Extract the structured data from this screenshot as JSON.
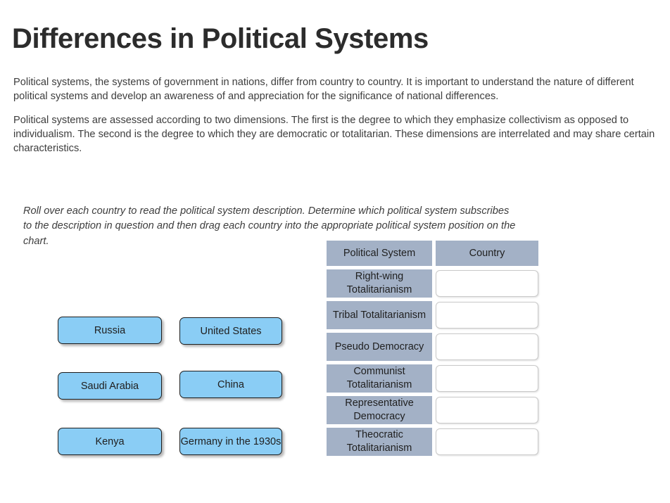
{
  "page": {
    "title": "Differences in Political Systems",
    "paragraphs": [
      "Political systems, the systems of government in nations, differ from country to country. It is important to understand the nature of different political systems and develop an awareness of and appreciation for the significance of national differences.",
      "Political systems are assessed according to two dimensions. The first is the degree to which they emphasize collectivism as opposed to individualism. The second is the degree to which they are democratic or totalitarian. These dimensions are interrelated and may share certain characteristics."
    ],
    "instructions": "Roll over each country to read the political system description. Determine which political system subscribes to the description in question and then drag each country into the appropriate political system position on the chart."
  },
  "countries": [
    {
      "label": "Russia"
    },
    {
      "label": "United States"
    },
    {
      "label": "Saudi Arabia"
    },
    {
      "label": "China"
    },
    {
      "label": "Kenya"
    },
    {
      "label": "Germany in the 1930s"
    }
  ],
  "table": {
    "headers": {
      "political_system": "Political System",
      "country": "Country"
    },
    "rows": [
      {
        "political_system": "Right-wing Totalitarianism",
        "country": ""
      },
      {
        "political_system": "Tribal Totalitarianism",
        "country": ""
      },
      {
        "political_system": "Pseudo Democracy",
        "country": ""
      },
      {
        "political_system": "Communist Totalitarianism",
        "country": ""
      },
      {
        "political_system": "Representative Democracy",
        "country": ""
      },
      {
        "political_system": "Theocratic Totalitarianism",
        "country": ""
      }
    ]
  },
  "colors": {
    "tile_fill": "#8ACDF5",
    "tile_border": "#1d1d1d",
    "header_cell": "#A3B1C6",
    "dropzone_border": "#c9c9c9",
    "title_text": "#2c2c2c",
    "body_text": "#3d3d3d"
  }
}
